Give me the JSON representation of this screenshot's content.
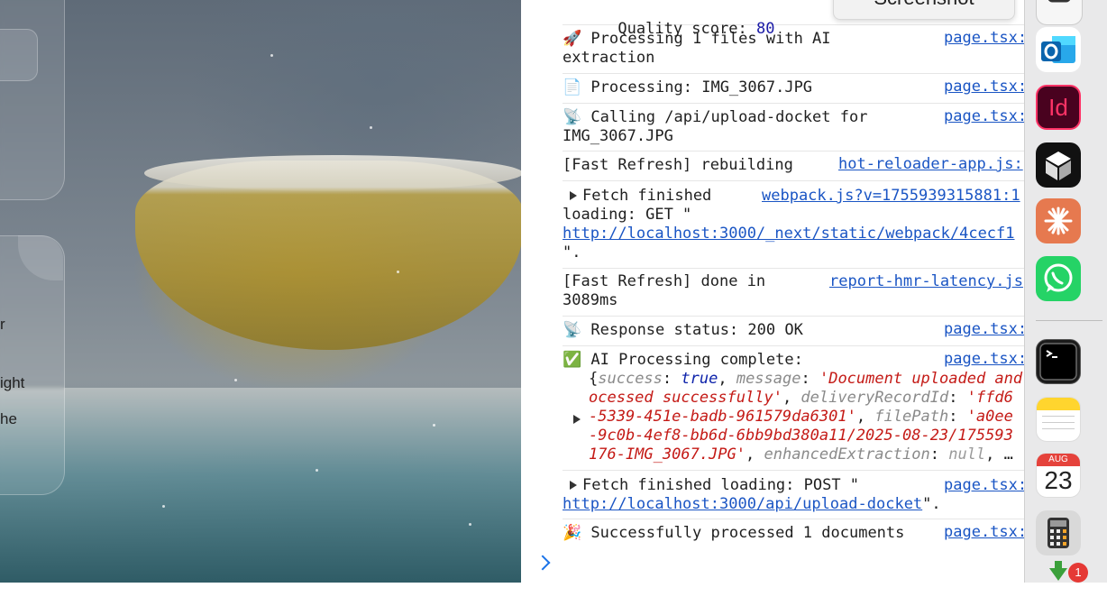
{
  "background": {
    "fragments": [
      "r",
      "ight",
      "he"
    ]
  },
  "toolbar": {
    "screenshot_label": "Screenshot"
  },
  "console": {
    "quality": {
      "label": "Quality score: ",
      "value": "80"
    },
    "rows": [
      {
        "msg_lines": [
          "🚀 Processing 1 files with AI",
          "extraction"
        ],
        "source": "page.tsx:"
      },
      {
        "msg_lines": [
          "📄 Processing: IMG_3067.JPG"
        ],
        "source": "page.tsx:"
      },
      {
        "msg_lines": [
          "📡 Calling /api/upload-docket for",
          "IMG_3067.JPG"
        ],
        "source": "page.tsx:"
      },
      {
        "msg_lines": [
          "[Fast Refresh] rebuilding"
        ],
        "source": "hot-reloader-app.js:"
      },
      {
        "msg_lines": [
          "Fetch finished",
          "loading: GET \""
        ],
        "link": "http://localhost:3000/_next/static/webpack/4cecf1",
        "tail": "\".",
        "source": "webpack.js?v=1755939315881:1"
      },
      {
        "msg_lines": [
          "[Fast Refresh] done in",
          "3089ms"
        ],
        "source": "report-hmr-latency.js"
      },
      {
        "msg_lines": [
          "📡 Response status: 200 OK"
        ],
        "source": "page.tsx:"
      },
      {
        "msg_lines": [
          "✅ AI Processing complete:"
        ],
        "source": "page.tsx:"
      },
      {
        "msg_lines": [
          "Fetch finished loading: POST \""
        ],
        "link": "http://localhost:3000/api/upload-docket",
        "tail": "\".",
        "source": "page.tsx:"
      },
      {
        "msg_lines": [
          "🎉 Successfully processed 1 documents"
        ],
        "source": "page.tsx:"
      }
    ],
    "object_preview": {
      "k1": "success",
      "v1": "true",
      "k2": "message",
      "v2": "'Document uploaded and pr",
      "v2b": "ocessed successfully'",
      "k3": "deliveryRecordId",
      "v3": "'ffd6",
      "v3b": "-5339-451e-badb-961579da6301'",
      "k4": "filePath",
      "v4": "'a0ee",
      "v4b": "-9c0b-4ef8-bb6d-6bb9bd380a11/2025-08-23/175593",
      "v4c": "176-IMG_3067.JPG'",
      "k5": "enhancedExtraction",
      "v5": "null",
      "ellipsis": "…"
    }
  },
  "dock": {
    "apps": [
      "screen-capture-app",
      "outlook-app",
      "indesign-app",
      "cube-app",
      "claude-app",
      "whatsapp-app",
      "terminal-app",
      "notes-app",
      "calendar-app",
      "calculator-app",
      "downloads-app"
    ],
    "calendar": {
      "month": "AUG",
      "day": "23"
    },
    "downloads_badge": "1",
    "indesign_label": "Id"
  },
  "colors": {
    "link": "#1a55c4",
    "string": "#c41a16",
    "number": "#1a1aa6"
  }
}
